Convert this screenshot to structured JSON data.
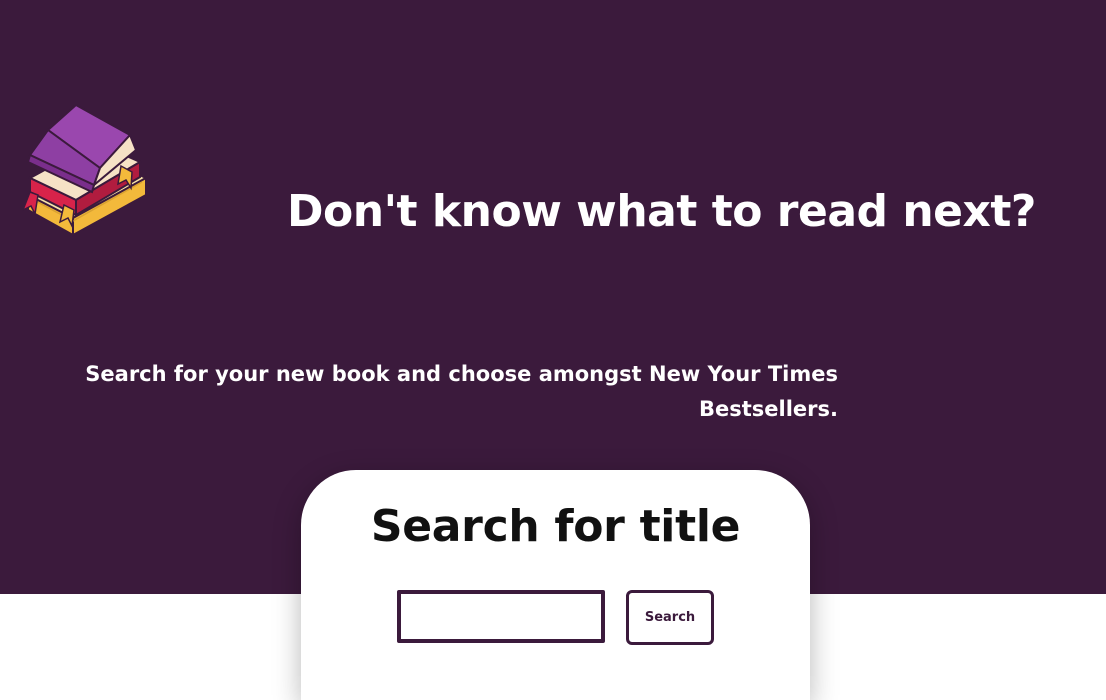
{
  "hero": {
    "title": "Don't know what to read next?",
    "subtitle": "Search for your new book and choose amongst New Your Times Bestsellers.",
    "logo_icon": "books-stack-icon"
  },
  "search_card": {
    "title": "Search for title",
    "input_value": "",
    "button_label": "Search"
  },
  "colors": {
    "brand": "#3b1a3c",
    "background": "#ffffff",
    "text_light": "#ffffff",
    "text_dark": "#111111"
  }
}
